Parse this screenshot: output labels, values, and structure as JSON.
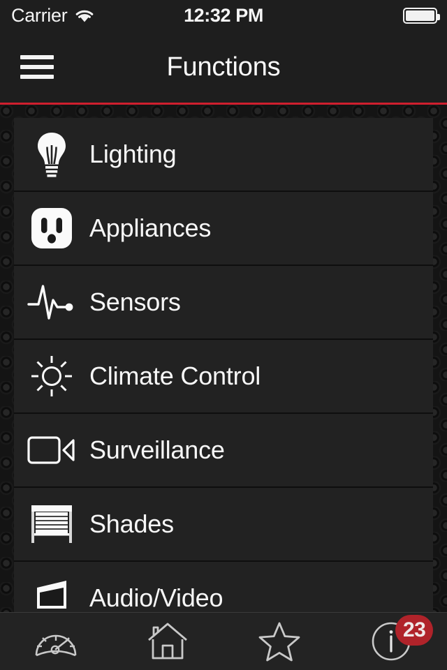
{
  "statusbar": {
    "carrier": "Carrier",
    "wifi_icon": "wifi-icon",
    "time": "12:32 PM",
    "battery_icon": "battery-full-icon"
  },
  "navbar": {
    "menu_icon": "hamburger-menu-icon",
    "title": "Functions",
    "accent_color": "#cf1f2e"
  },
  "list": {
    "items": [
      {
        "label": "Lighting",
        "icon": "lightbulb-icon"
      },
      {
        "label": "Appliances",
        "icon": "power-outlet-icon"
      },
      {
        "label": "Sensors",
        "icon": "pulse-waveform-icon"
      },
      {
        "label": "Climate Control",
        "icon": "sun-icon"
      },
      {
        "label": "Surveillance",
        "icon": "video-camera-icon"
      },
      {
        "label": "Shades",
        "icon": "window-blind-icon"
      },
      {
        "label": "Audio/Video",
        "icon": "television-icon"
      }
    ]
  },
  "tabbar": {
    "tabs": [
      {
        "name": "dashboard",
        "icon": "gauge-icon",
        "badge": ""
      },
      {
        "name": "home",
        "icon": "house-icon",
        "badge": ""
      },
      {
        "name": "favorites",
        "icon": "star-icon",
        "badge": ""
      },
      {
        "name": "info",
        "icon": "info-circle-icon",
        "badge": "23"
      }
    ],
    "badge_color": "#b0232a"
  }
}
